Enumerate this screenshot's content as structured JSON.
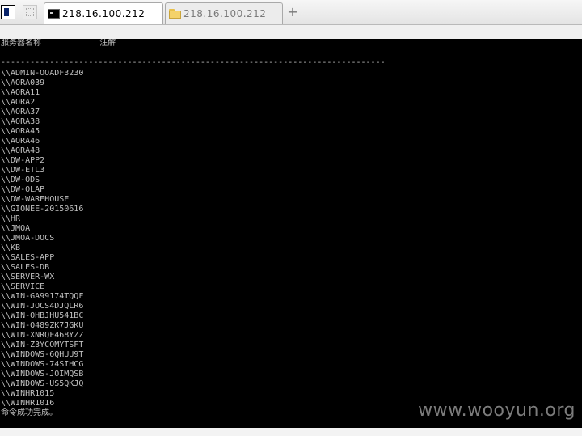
{
  "tabs": [
    {
      "label": "218.16.100.212",
      "icon": "terminal-icon",
      "active": true
    },
    {
      "label": "218.16.100.212",
      "icon": "folder-icon",
      "active": false
    }
  ],
  "new_tab_label": "+",
  "terminal": {
    "header": "服务器名称            注解",
    "separator": "-------------------------------------------------------------------------------",
    "servers": [
      "\\\\ADMIN-OOADF3230",
      "\\\\AORA039",
      "\\\\AORA11",
      "\\\\AORA2",
      "\\\\AORA37",
      "\\\\AORA38",
      "\\\\AORA45",
      "\\\\AORA46",
      "\\\\AORA48",
      "\\\\DW-APP2",
      "\\\\DW-ETL3",
      "\\\\DW-ODS",
      "\\\\DW-OLAP",
      "\\\\DW-WAREHOUSE",
      "\\\\GIONEE-20150616",
      "\\\\HR",
      "\\\\JMOA",
      "\\\\JMOA-DOCS",
      "\\\\KB",
      "\\\\SALES-APP",
      "\\\\SALES-DB",
      "\\\\SERVER-WX",
      "\\\\SERVICE",
      "\\\\WIN-GA99174TQQF",
      "\\\\WIN-JOCS4DJQLR6",
      "\\\\WIN-OHBJHU541BC",
      "\\\\WIN-Q489ZK7JGKU",
      "\\\\WIN-XNRQF468YZZ",
      "\\\\WIN-Z3YCOMYTSFT",
      "\\\\WINDOWS-6QHUU9T",
      "\\\\WINDOWS-74SIHCG",
      "\\\\WINDOWS-JOIMQSB",
      "\\\\WINDOWS-US5QKJQ",
      "\\\\WINHR1015",
      "\\\\WINHR1016"
    ],
    "footer": "命令成功完成。"
  },
  "watermark": "www.wooyun.org",
  "colors": {
    "terminal_bg": "#000000",
    "terminal_fg": "#c0c0c0",
    "tabbar_bg": "#e8e8e8"
  }
}
